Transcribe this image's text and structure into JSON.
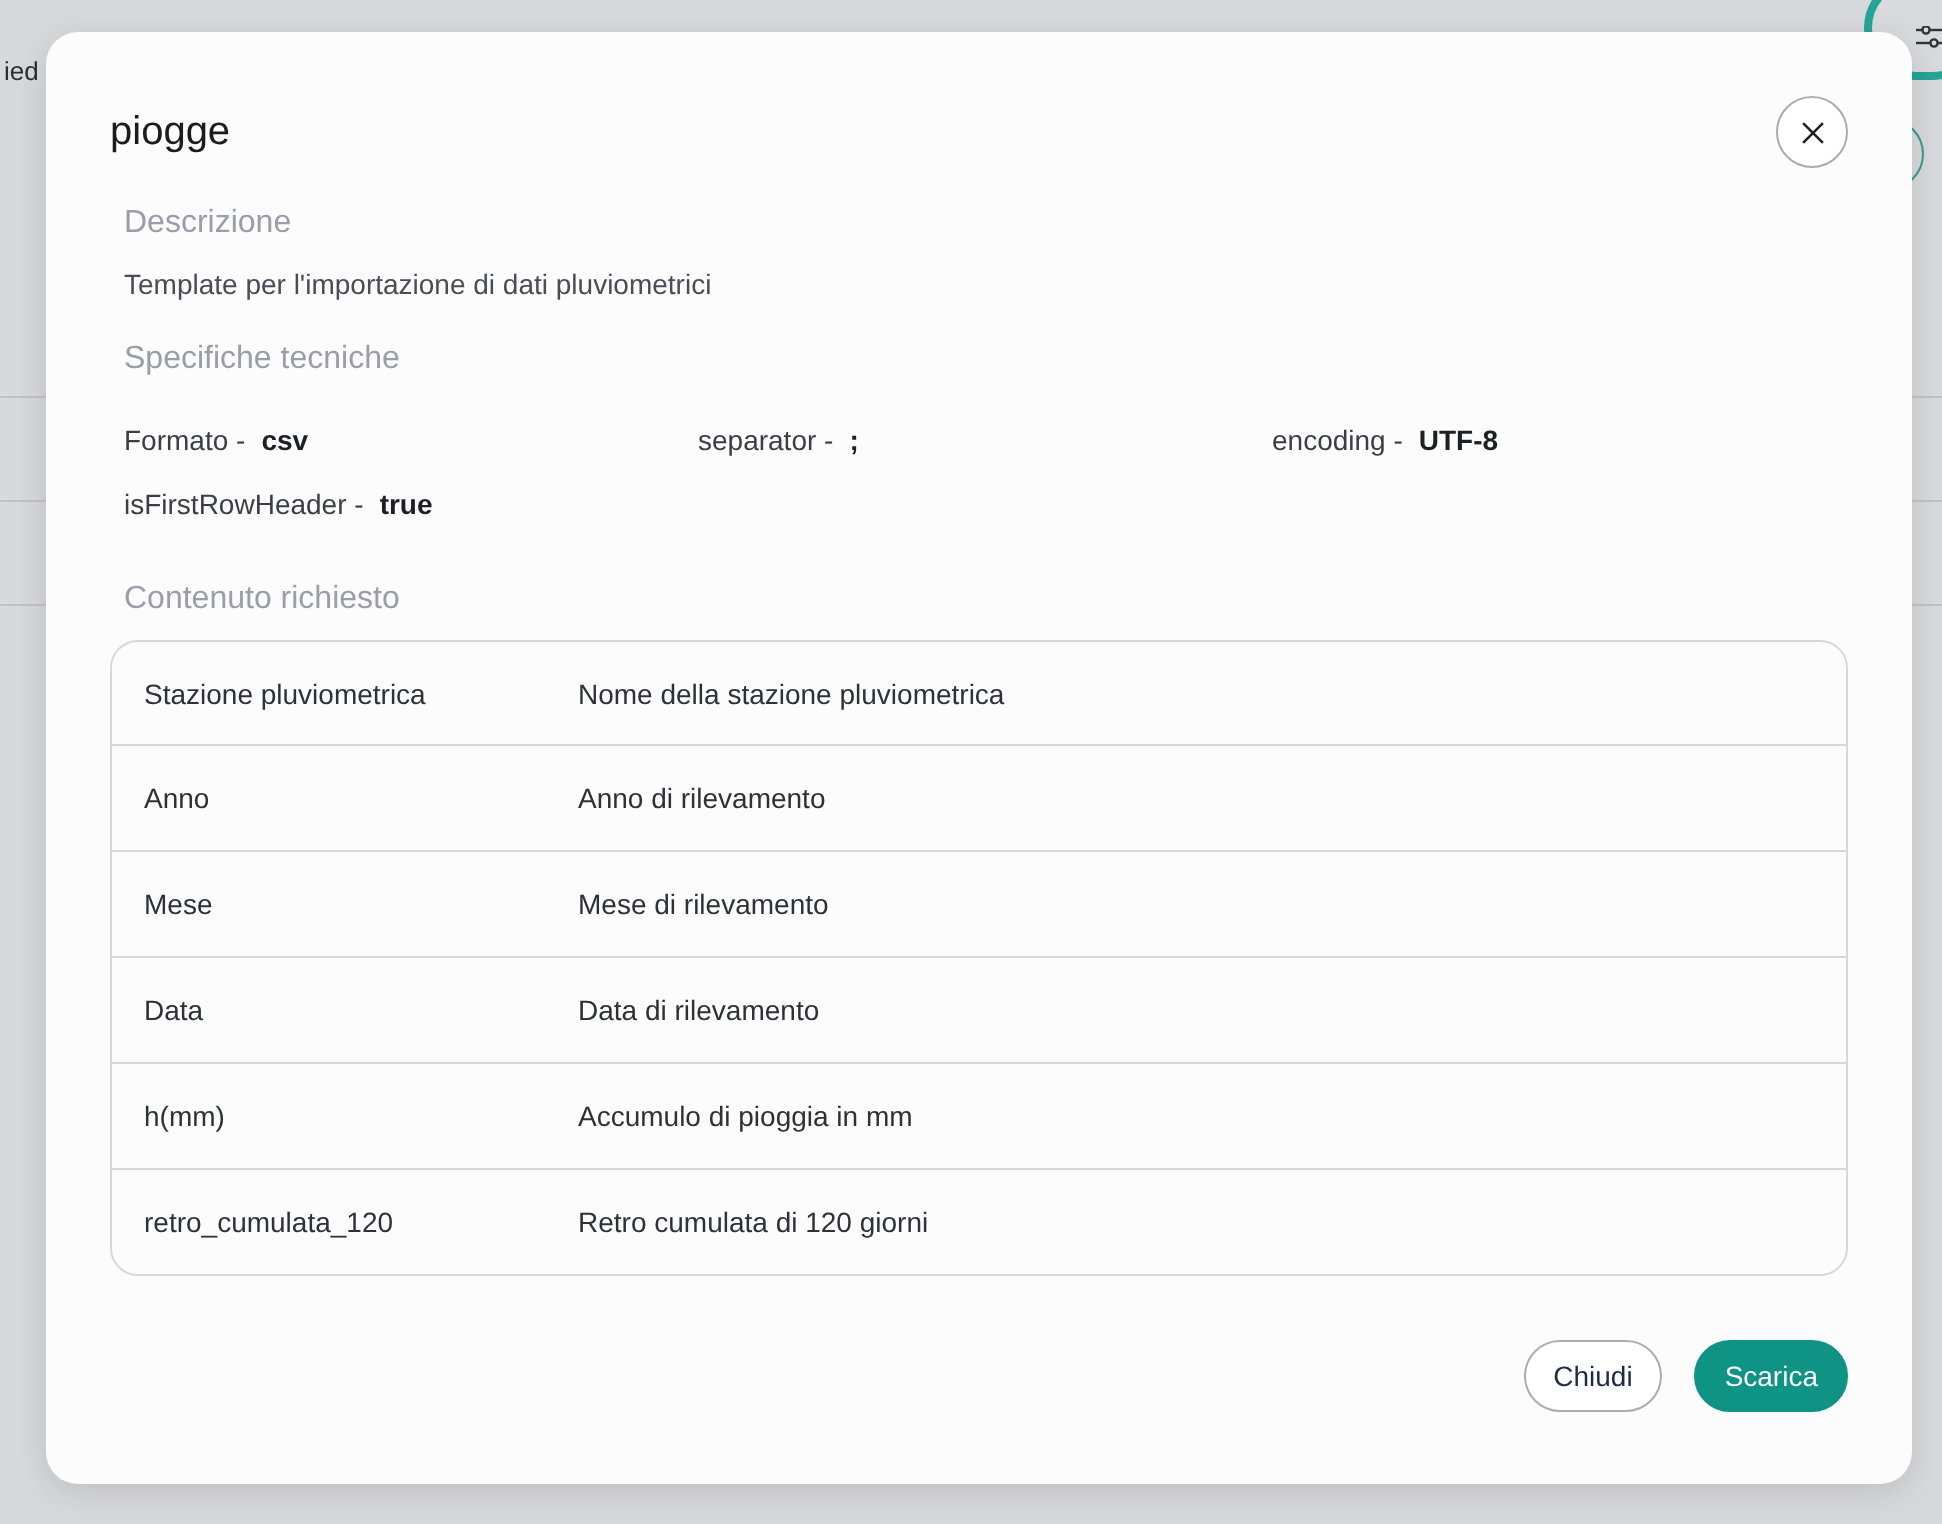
{
  "background": {
    "text": "ied"
  },
  "dialog": {
    "title": "piogge",
    "description": {
      "heading": "Descrizione",
      "text": "Template per l'importazione di dati pluviometrici"
    },
    "specs": {
      "heading": "Specifiche tecniche",
      "items": [
        {
          "label": "Formato -",
          "value": "csv"
        },
        {
          "label": "separator -",
          "value": ";"
        },
        {
          "label": "encoding -",
          "value": "UTF-8"
        },
        {
          "label": "isFirstRowHeader -",
          "value": "true"
        }
      ]
    },
    "content": {
      "heading": "Contenuto richiesto",
      "rows": [
        {
          "field": "Stazione pluviometrica",
          "description": "Nome della stazione pluviometrica"
        },
        {
          "field": "Anno",
          "description": "Anno di rilevamento"
        },
        {
          "field": "Mese",
          "description": "Mese di rilevamento"
        },
        {
          "field": "Data",
          "description": "Data di rilevamento"
        },
        {
          "field": "h(mm)",
          "description": "Accumulo di pioggia in mm"
        },
        {
          "field": "retro_cumulata_120",
          "description": "Retro cumulata di 120 giorni"
        }
      ]
    },
    "buttons": [
      {
        "label": "Chiudi",
        "kind": "secondary"
      },
      {
        "label": "Scarica",
        "kind": "primary"
      }
    ]
  }
}
